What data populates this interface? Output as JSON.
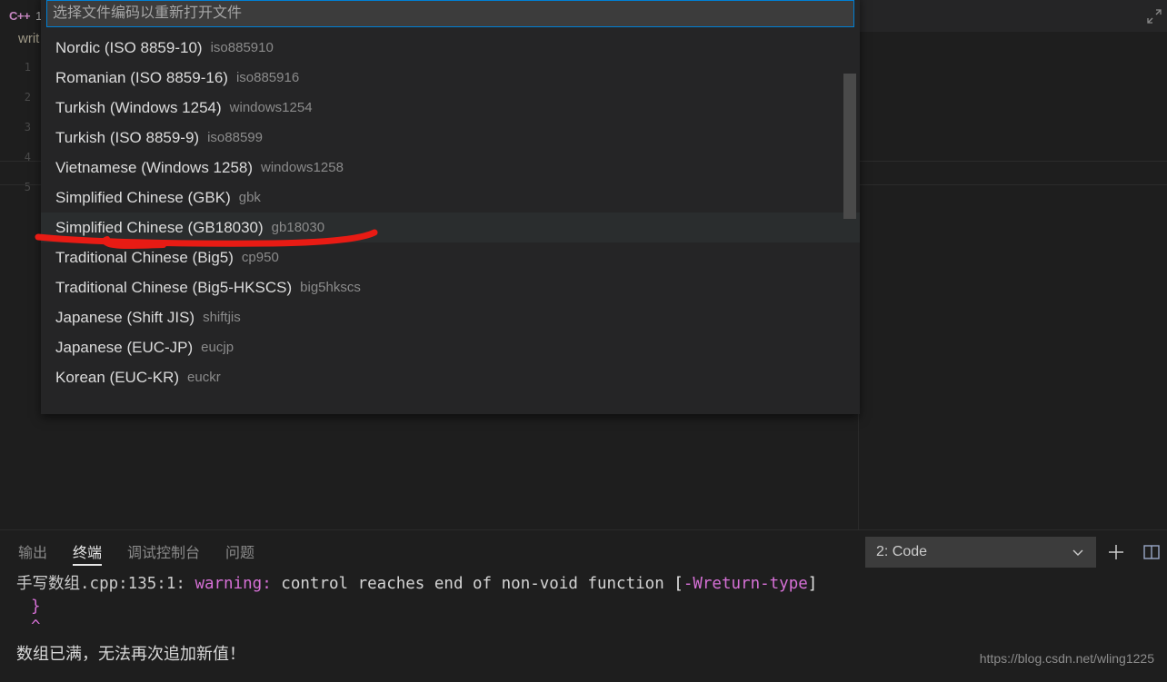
{
  "editor": {
    "tab": {
      "icon": "cpp-file-icon",
      "icon_label": "C++",
      "title": "1"
    },
    "breadcrumb": "writ",
    "line_numbers": [
      "1",
      "2",
      "3",
      "4",
      "5"
    ],
    "tab_action_icon": "split-editor-icon"
  },
  "quick_pick": {
    "placeholder": "选择文件编码以重新打开文件",
    "value": "",
    "items": [
      {
        "label": "Nordic (ISO 8859-10)",
        "description": "iso885910",
        "focused": false
      },
      {
        "label": "Romanian (ISO 8859-16)",
        "description": "iso885916",
        "focused": false
      },
      {
        "label": "Turkish (Windows 1254)",
        "description": "windows1254",
        "focused": false
      },
      {
        "label": "Turkish (ISO 8859-9)",
        "description": "iso88599",
        "focused": false
      },
      {
        "label": "Vietnamese (Windows 1258)",
        "description": "windows1258",
        "focused": false
      },
      {
        "label": "Simplified Chinese (GBK)",
        "description": "gbk",
        "focused": false
      },
      {
        "label": "Simplified Chinese (GB18030)",
        "description": "gb18030",
        "focused": true
      },
      {
        "label": "Traditional Chinese (Big5)",
        "description": "cp950",
        "focused": false
      },
      {
        "label": "Traditional Chinese (Big5-HKSCS)",
        "description": "big5hkscs",
        "focused": false
      },
      {
        "label": "Japanese (Shift JIS)",
        "description": "shiftjis",
        "focused": false
      },
      {
        "label": "Japanese (EUC-JP)",
        "description": "eucjp",
        "focused": false
      },
      {
        "label": "Korean (EUC-KR)",
        "description": "euckr",
        "focused": false
      }
    ]
  },
  "annotation": {
    "color": "#e81b14",
    "shape": "hand-drawn-underline"
  },
  "panel": {
    "tabs": [
      {
        "label": "输出",
        "active": false
      },
      {
        "label": "终端",
        "active": true
      },
      {
        "label": "调试控制台",
        "active": false
      },
      {
        "label": "问题",
        "active": false
      }
    ],
    "terminal_select": {
      "value": "2: Code",
      "chevron_icon": "chevron-down-icon"
    },
    "actions": [
      {
        "icon": "add-terminal-icon",
        "glyph": "+"
      },
      {
        "icon": "split-terminal-icon",
        "glyph": ""
      }
    ],
    "terminal_output": {
      "line1": {
        "file": "手写数组.cpp:135:1:",
        "severity": "warning:",
        "message": "control reaches end of non-void function",
        "bracket_open": "[",
        "flag": "-Wreturn-type",
        "bracket_close": "]"
      },
      "line2": "}",
      "line3": "^",
      "line4": "数组已满，无法再次追加新值！"
    }
  },
  "watermark": "https://blog.csdn.net/wling1225"
}
